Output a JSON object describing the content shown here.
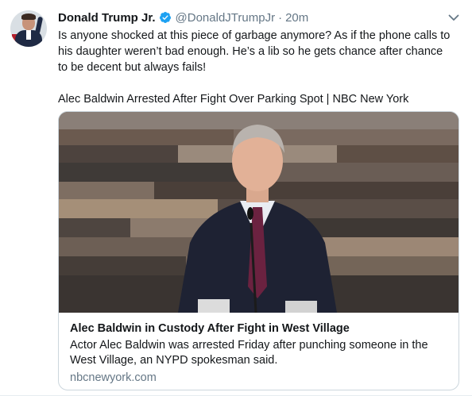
{
  "tweet": {
    "author_name": "Donald Trump Jr.",
    "handle": "@DonaldJTrumpJr",
    "separator": "·",
    "time": "20m",
    "text": "Is anyone shocked at this piece of garbage anymore? As if the phone calls to his daughter weren’t bad enough. He’s a lib so he gets chance after chance to be decent but always fails!",
    "link_text": "Alec Baldwin Arrested After Fight Over Parking Spot | NBC New York",
    "icons": {
      "verified": "verified-badge-icon",
      "menu": "chevron-down-icon"
    },
    "colors": {
      "verified": "#1da1f2",
      "secondary": "#657786",
      "border": "#ccd6dd"
    }
  },
  "card": {
    "title": "Alec Baldwin in Custody After Fight in West Village",
    "description": "Actor Alec Baldwin was arrested Friday after punching someone in the West Village, an NYPD spokesman said.",
    "domain": "nbcnewyork.com"
  }
}
